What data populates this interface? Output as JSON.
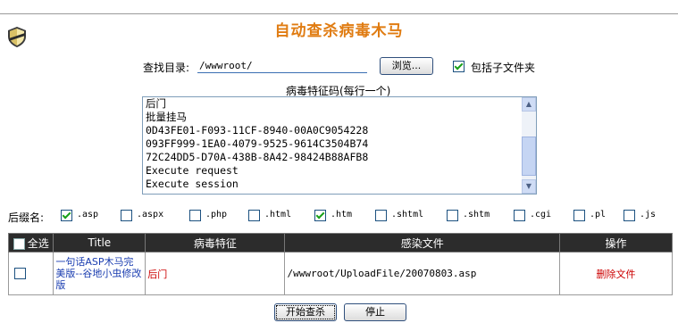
{
  "header": {
    "title": "自动查杀病毒木马",
    "logo_icon": "shield-icon"
  },
  "search": {
    "dir_label": "查找目录:",
    "dir_value": "/wwwroot/",
    "browse_label": "浏览...",
    "include_sub_label": "包括子文件夹",
    "include_sub_checked": true
  },
  "signatures": {
    "label": "病毒特征码(每行一个)",
    "lines": [
      "后门",
      "批量挂马",
      "0D43FE01-F093-11CF-8940-00A0C9054228",
      "093FF999-1EA0-4079-9525-9614C3504B74",
      "72C24DD5-D70A-438B-8A42-98424B88AFB8",
      "Execute request",
      "Execute session"
    ]
  },
  "extensions": {
    "label": "后缀名:",
    "items": [
      {
        "name": ".asp",
        "checked": true
      },
      {
        "name": ".aspx",
        "checked": false
      },
      {
        "name": ".php",
        "checked": false
      },
      {
        "name": ".html",
        "checked": false
      },
      {
        "name": ".htm",
        "checked": true
      },
      {
        "name": ".shtml",
        "checked": false
      },
      {
        "name": ".shtm",
        "checked": false
      },
      {
        "name": ".cgi",
        "checked": false
      },
      {
        "name": ".pl",
        "checked": false
      },
      {
        "name": ".js",
        "checked": false
      }
    ]
  },
  "table": {
    "headers": {
      "select_all": "全选",
      "title": "Title",
      "signature": "病毒特征",
      "file": "感染文件",
      "action": "操作"
    },
    "rows": [
      {
        "title": "一句话ASP木马完美版--谷地小虫修改版",
        "signature": "后门",
        "file": "/wwwroot/UploadFile/20070803.asp",
        "action": "删除文件"
      }
    ]
  },
  "footer": {
    "start_label": "开始查杀",
    "stop_label": "停止"
  },
  "colors": {
    "title": "#e07c12",
    "header_bg": "#2c2c2c",
    "danger": "#cc0000",
    "link": "#1a3db0"
  }
}
